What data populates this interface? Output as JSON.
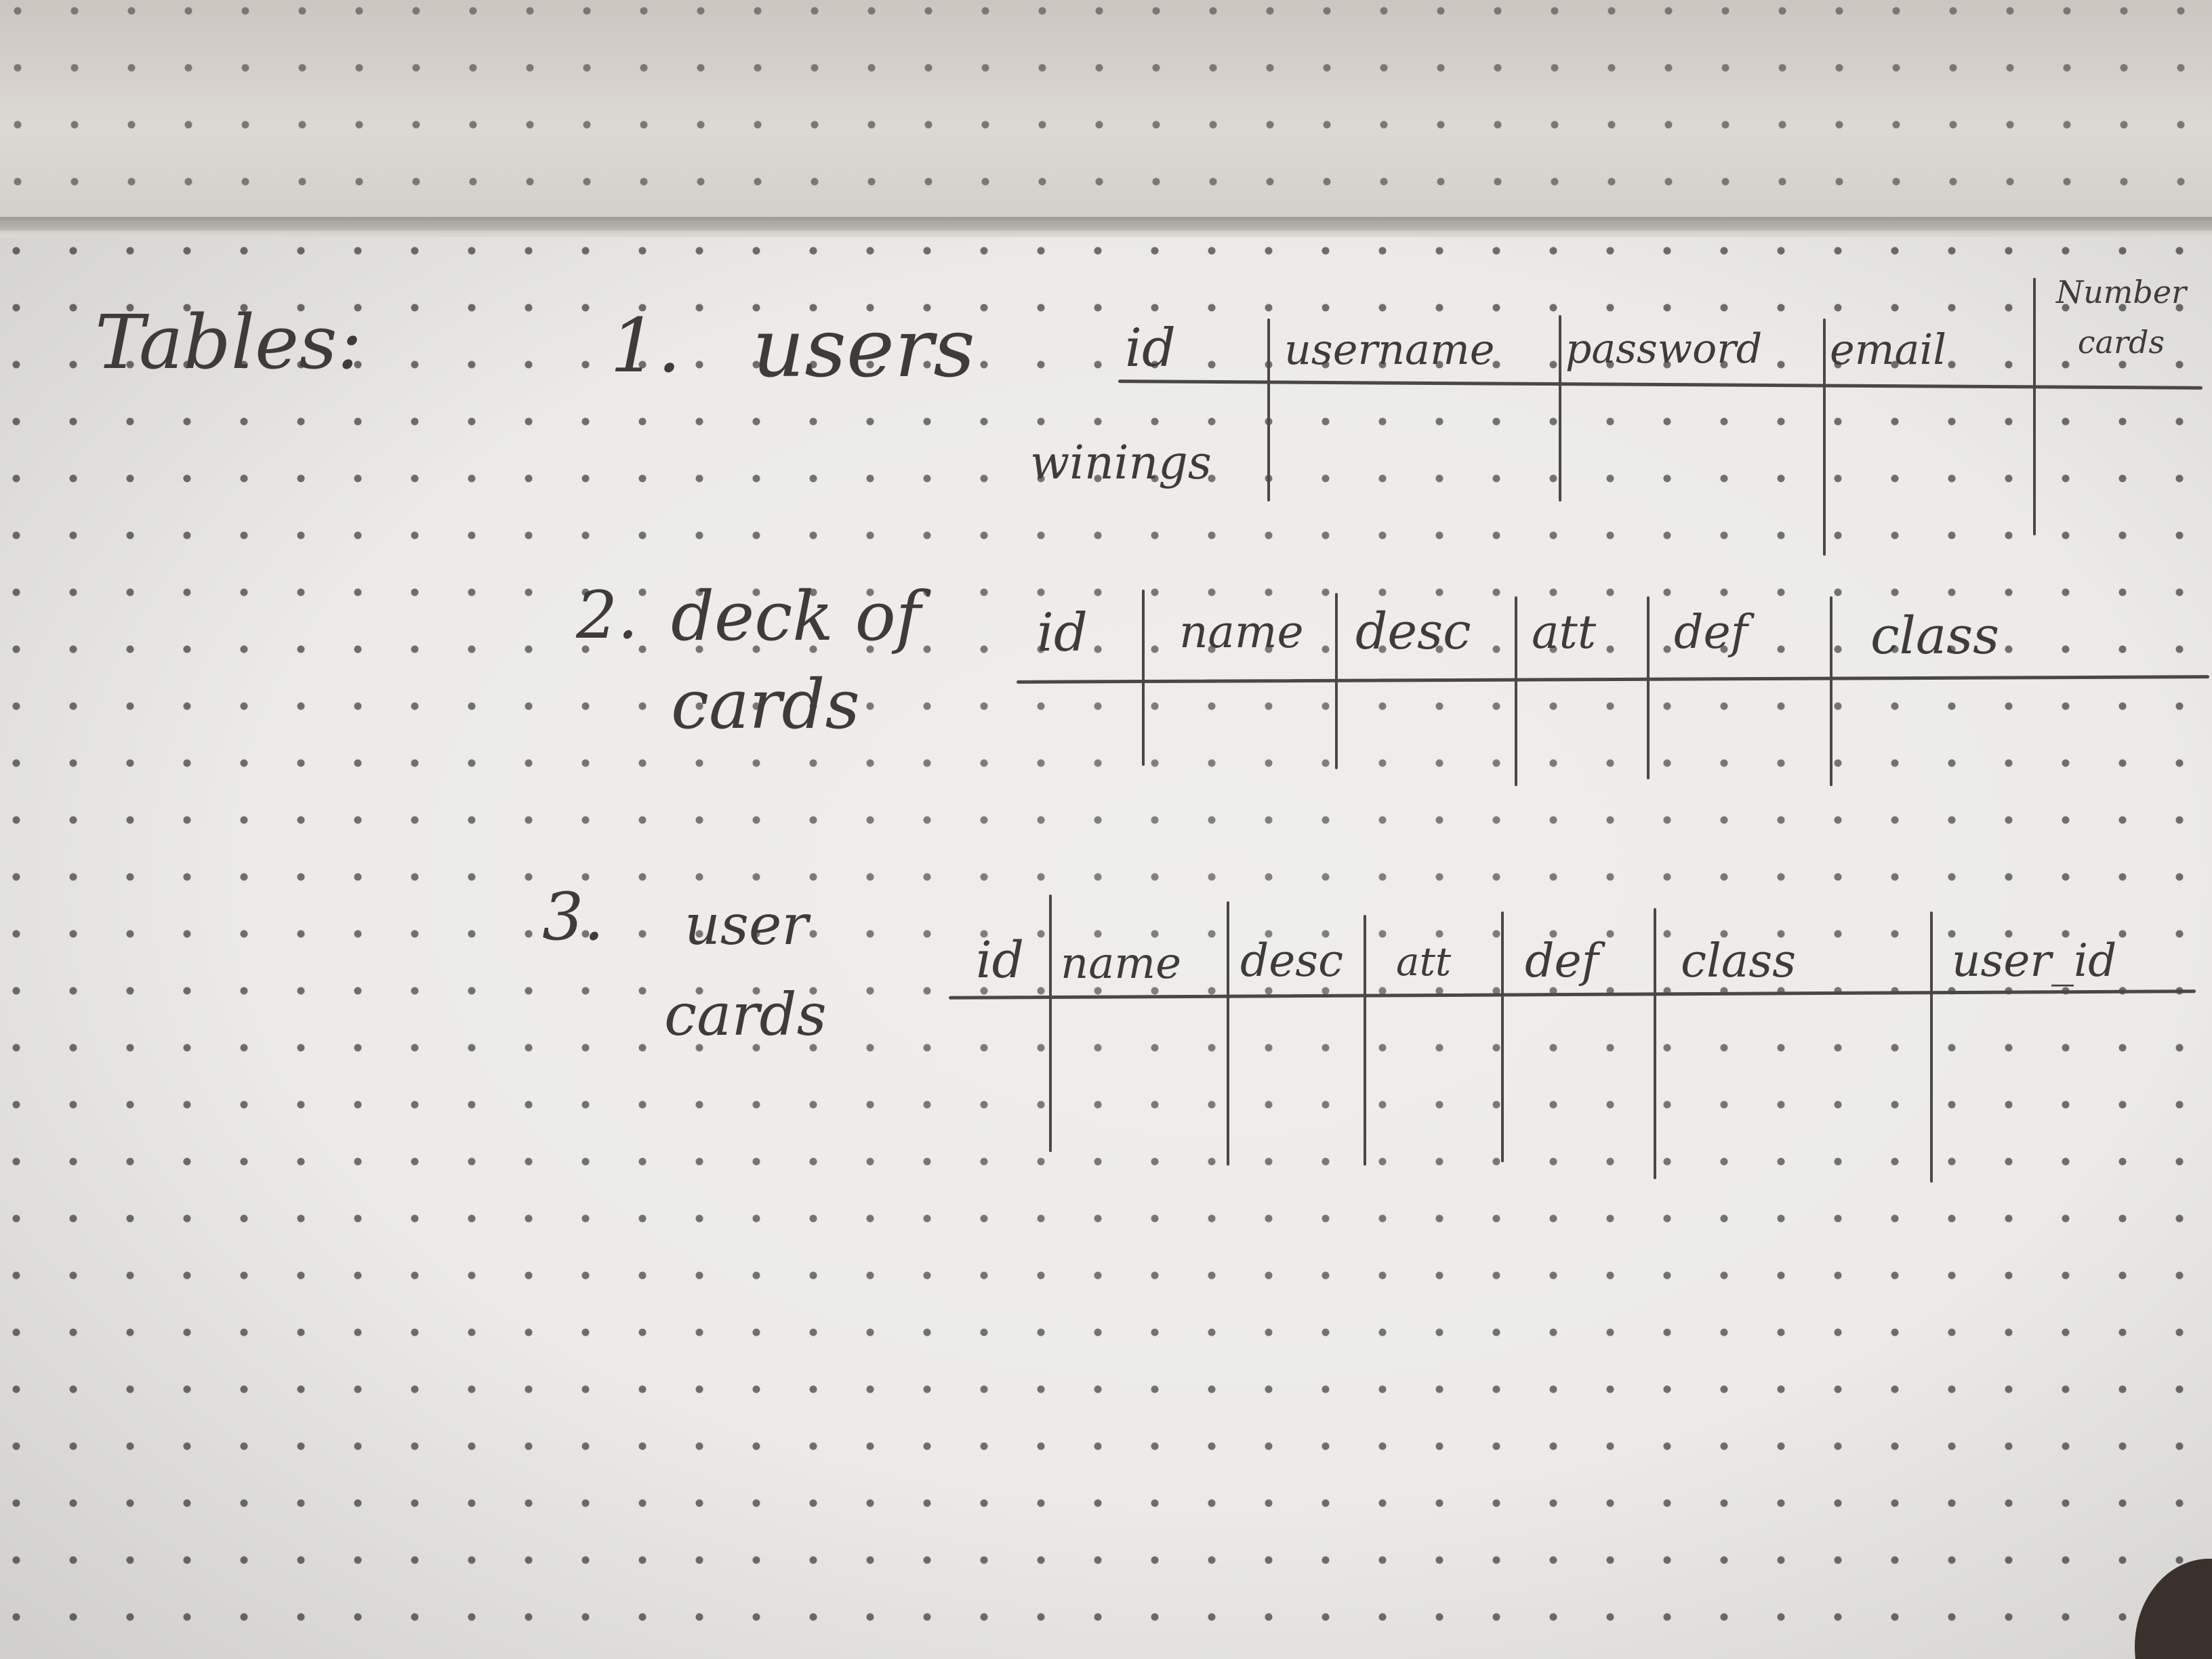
{
  "heading": "Tables:",
  "tables": [
    {
      "number": "1.",
      "name_line1": "users",
      "name_line2": "",
      "columns": [
        "id",
        "username",
        "password",
        "email",
        "Number cards"
      ],
      "extra_column": "winings"
    },
    {
      "number": "2.",
      "name_line1": "deck of",
      "name_line2": "cards",
      "columns": [
        "id",
        "name",
        "desc",
        "att",
        "def",
        "class"
      ]
    },
    {
      "number": "3.",
      "name_line1": "user",
      "name_line2": "cards",
      "columns": [
        "id",
        "name",
        "desc",
        "att",
        "def",
        "class",
        "user_id"
      ]
    }
  ]
}
